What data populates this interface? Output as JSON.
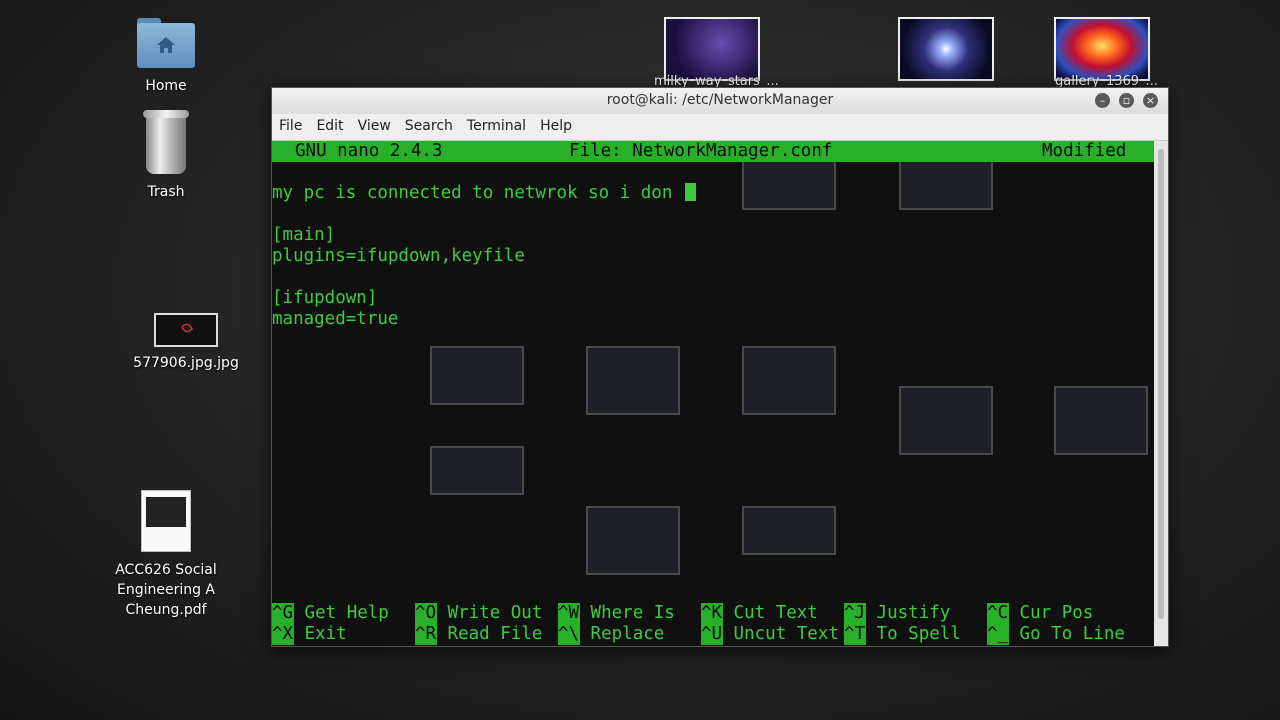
{
  "desktop": {
    "icons": [
      {
        "label": "Home"
      },
      {
        "label": "Trash"
      },
      {
        "label": "577906.jpg.jpg"
      },
      {
        "label": "ACC626 Social Engineering A Cheung.pdf"
      }
    ],
    "top_files": [
      {
        "label": "milky_way_stars_..."
      },
      {
        "label": ""
      },
      {
        "label": "gallery_1369_..."
      }
    ]
  },
  "window": {
    "title": "root@kali: /etc/NetworkManager",
    "menu": [
      "File",
      "Edit",
      "View",
      "Search",
      "Terminal",
      "Help"
    ]
  },
  "nano": {
    "version": "GNU nano 2.4.3",
    "file": "File: NetworkManager.conf",
    "status": "Modified",
    "lines": [
      "my pc is connected to netwrok so i don ",
      "",
      "[main]",
      "plugins=ifupdown,keyfile",
      "",
      "[ifupdown]",
      "managed=true"
    ],
    "shortcuts": [
      {
        "key": "^G",
        "label": "Get Help"
      },
      {
        "key": "^O",
        "label": "Write Out"
      },
      {
        "key": "^W",
        "label": "Where Is"
      },
      {
        "key": "^K",
        "label": "Cut Text"
      },
      {
        "key": "^J",
        "label": "Justify"
      },
      {
        "key": "^C",
        "label": "Cur Pos"
      },
      {
        "key": "^X",
        "label": "Exit"
      },
      {
        "key": "^R",
        "label": "Read File"
      },
      {
        "key": "^\\",
        "label": "Replace"
      },
      {
        "key": "^U",
        "label": "Uncut Text"
      },
      {
        "key": "^T",
        "label": "To Spell"
      },
      {
        "key": "^_",
        "label": "Go To Line"
      }
    ]
  },
  "colors": {
    "terminal_green": "#3ecb3e",
    "nano_bar": "#28b02b"
  }
}
